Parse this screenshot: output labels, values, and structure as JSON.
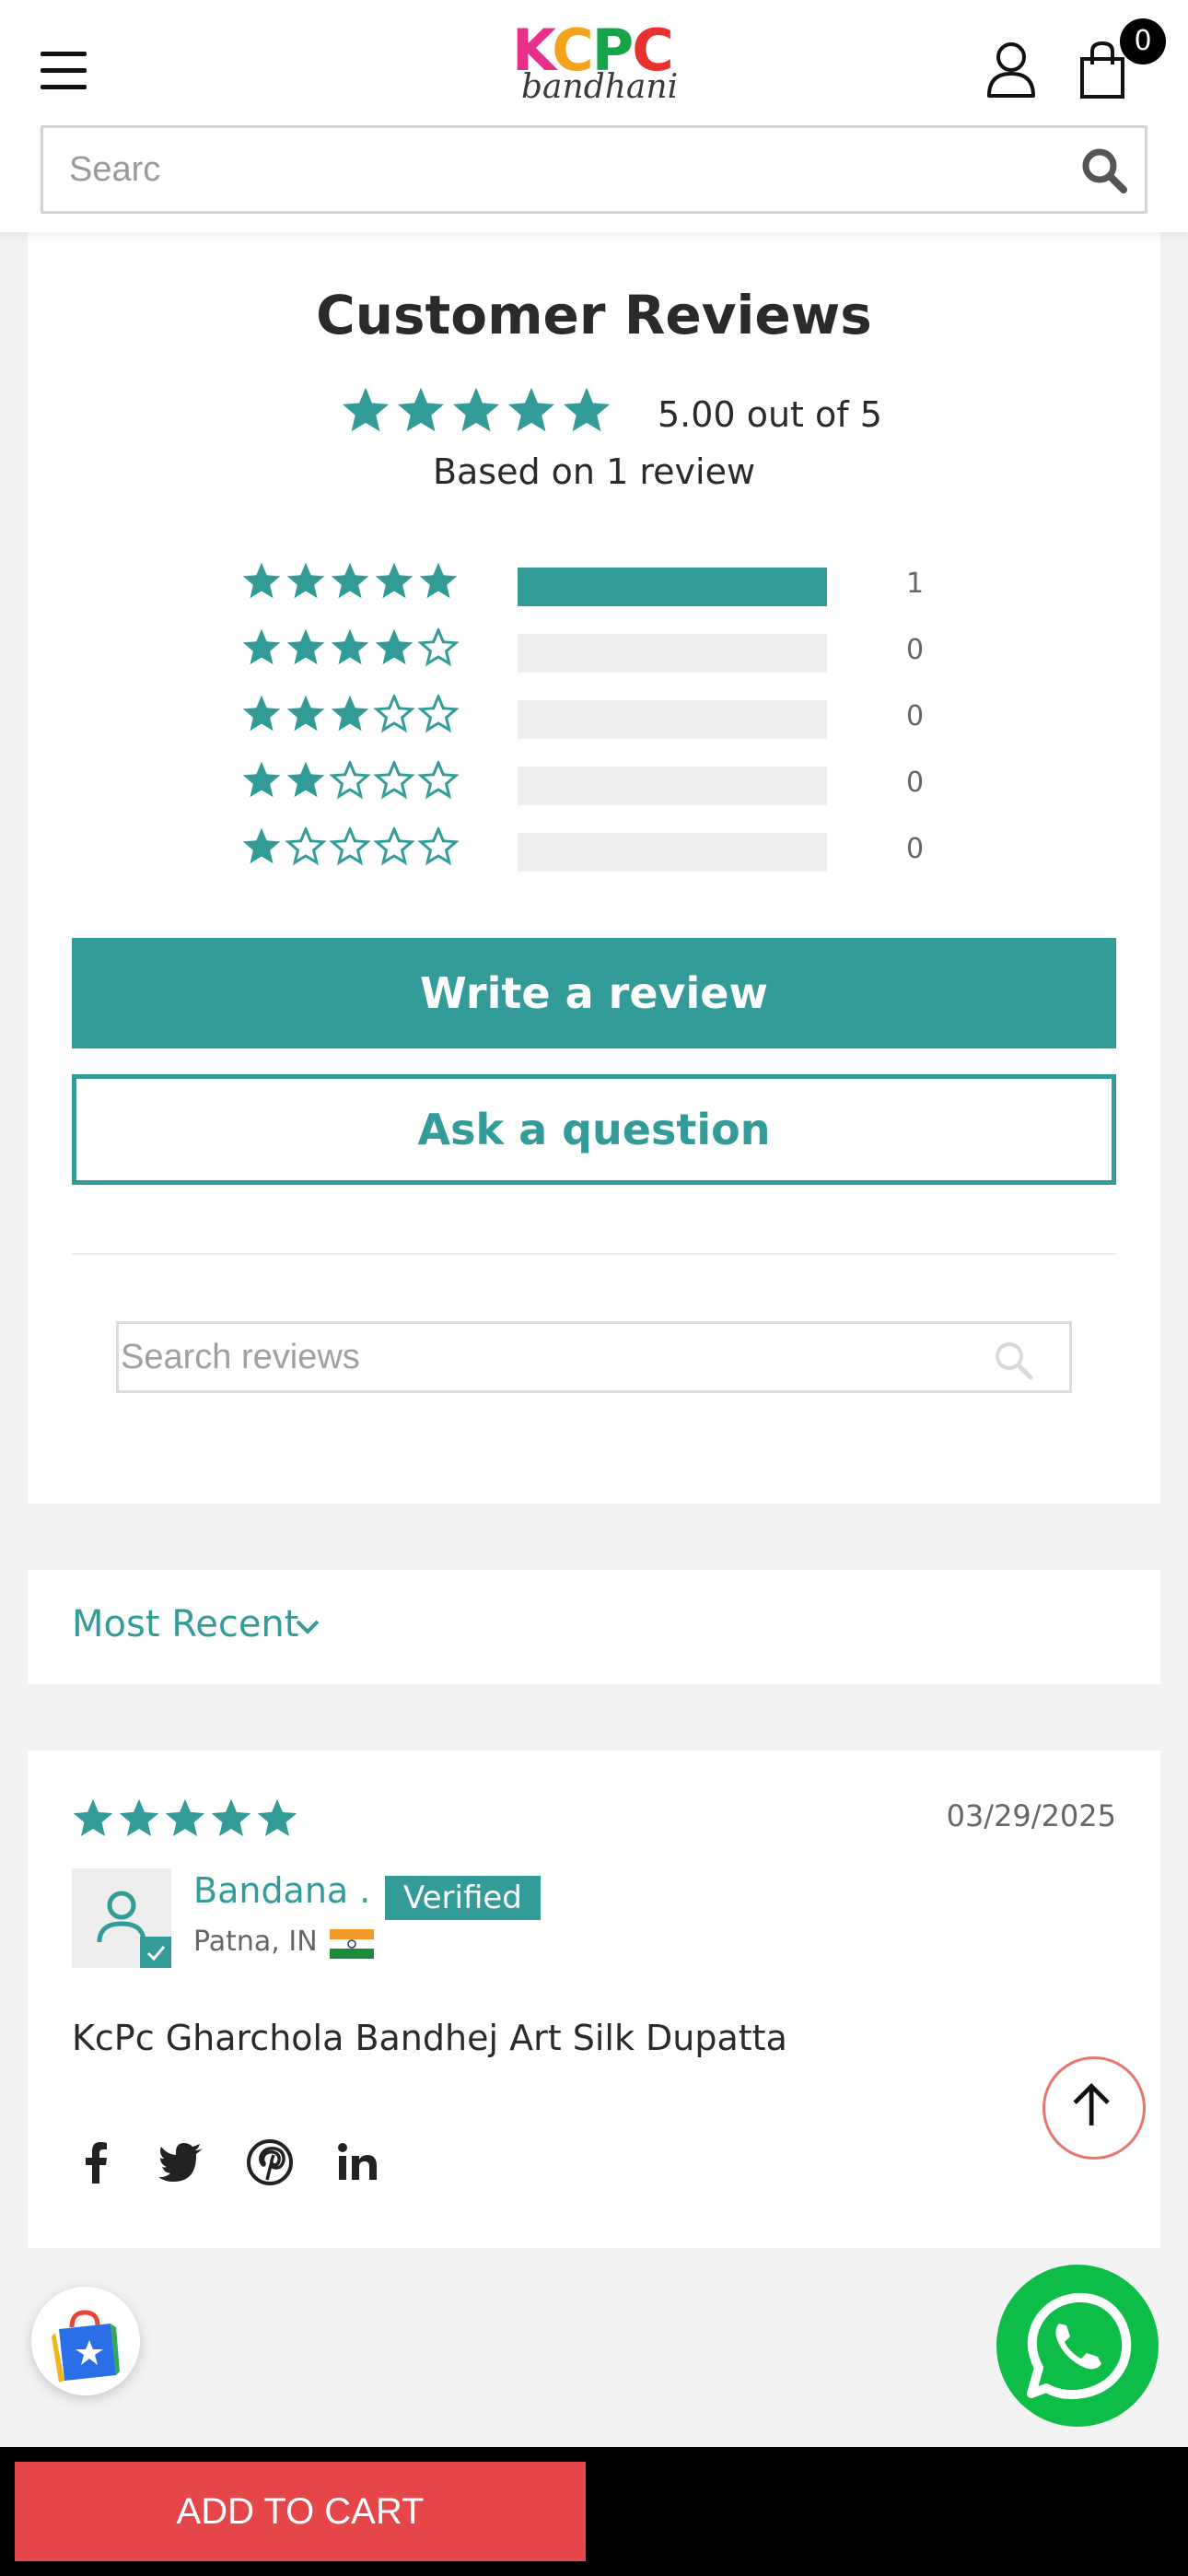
{
  "header": {
    "logo_main": "KCPC",
    "logo_sub": "bandhani",
    "cart_count": "0",
    "search_placeholder": "Searc"
  },
  "reviews_summary": {
    "title": "Customer Reviews",
    "average_text": "5.00 out of 5",
    "average_rating": 5,
    "based_on": "Based on 1 review",
    "histogram": [
      {
        "stars": 5,
        "count": "1",
        "fraction": 1.0
      },
      {
        "stars": 4,
        "count": "0",
        "fraction": 0
      },
      {
        "stars": 3,
        "count": "0",
        "fraction": 0
      },
      {
        "stars": 2,
        "count": "0",
        "fraction": 0
      },
      {
        "stars": 1,
        "count": "0",
        "fraction": 0
      }
    ],
    "write_review_label": "Write a review",
    "ask_question_label": "Ask a question",
    "search_reviews_placeholder": "Search reviews"
  },
  "sort": {
    "label": "Most Recent"
  },
  "review": {
    "rating": 5,
    "date": "03/29/2025",
    "author": "Bandana .",
    "verified_label": "Verified",
    "location": "Patna, IN",
    "body": "KcPc Gharchola Bandhej Art Silk Dupatta",
    "share_icons": [
      "facebook-icon",
      "twitter-icon",
      "pinterest-icon",
      "linkedin-icon"
    ]
  },
  "bottom": {
    "add_to_cart_label": "ADD TO CART"
  },
  "colors": {
    "accent": "#339b98",
    "cart_button": "#e5464a",
    "whatsapp": "#0dbd47"
  }
}
